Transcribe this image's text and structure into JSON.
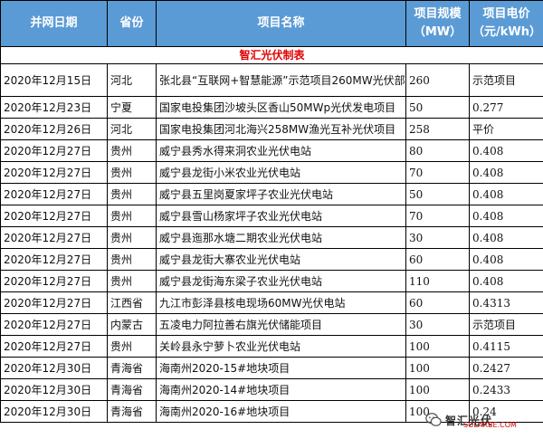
{
  "colors": {
    "header_bg": "#5b9bd5",
    "header_text": "#ffffff",
    "subtitle_text": "#e00000",
    "border": "#000000"
  },
  "header": {
    "col_date": "并网日期",
    "col_province": "省份",
    "col_name": "项目名称",
    "col_scale": "项目规模（MW）",
    "col_price": "项目电价（元/kWh）"
  },
  "subtitle": "智汇光伏制表",
  "rows": [
    {
      "date": "2020年12月15日",
      "province": "河北",
      "name": "张北县“互联网+智慧能源”示范项目260MW光伏部分",
      "scale": "260",
      "price": "示范项目"
    },
    {
      "date": "2020年12月23日",
      "province": "宁夏",
      "name": "国家电投集团沙坡头区香山50MWp光伏发电项目",
      "scale": "50",
      "price": "0.277"
    },
    {
      "date": "2020年12月26日",
      "province": "河北",
      "name": "国家电投集团河北海兴258MW渔光互补光伏项目",
      "scale": "258",
      "price": "平价"
    },
    {
      "date": "2020年12月27日",
      "province": "贵州",
      "name": "威宁县秀水得来洞农业光伏电站",
      "scale": "80",
      "price": "0.408"
    },
    {
      "date": "2020年12月27日",
      "province": "贵州",
      "name": "威宁县龙街小米农业光伏电站",
      "scale": "70",
      "price": "0.408"
    },
    {
      "date": "2020年12月27日",
      "province": "贵州",
      "name": "威宁县五里岗夏家坪子农业光伏电站",
      "scale": "50",
      "price": "0.408"
    },
    {
      "date": "2020年12月27日",
      "province": "贵州",
      "name": "威宁县雪山杨家坪子农业光伏电站",
      "scale": "70",
      "price": "0.408"
    },
    {
      "date": "2020年12月27日",
      "province": "贵州",
      "name": "威宁县迤那水塘二期农业光伏电站",
      "scale": "30",
      "price": "0.408"
    },
    {
      "date": "2020年12月27日",
      "province": "贵州",
      "name": "威宁县龙街大寨农业光伏电站",
      "scale": "60",
      "price": "0.408"
    },
    {
      "date": "2020年12月27日",
      "province": "贵州",
      "name": "威宁县龙街海东梁子农业光伏电站",
      "scale": "110",
      "price": "0.408"
    },
    {
      "date": "2020年12月27日",
      "province": "江西省",
      "name": "九江市彭泽县核电现场60MW光伏电站",
      "scale": "60",
      "price": "0.4313"
    },
    {
      "date": "2020年12月27日",
      "province": "内蒙古",
      "name": "五凌电力阿拉善右旗光伏储能项目",
      "scale": "30",
      "price": "示范项目"
    },
    {
      "date": "2020年12月27日",
      "province": "贵州",
      "name": "关岭县永宁萝卜农业光伏电站",
      "scale": "100",
      "price": "0.4115"
    },
    {
      "date": "2020年12月30日",
      "province": "青海省",
      "name": "海南州2020-15#地块项目",
      "scale": "100",
      "price": "0.2427"
    },
    {
      "date": "2020年12月30日",
      "province": "青海省",
      "name": "海南州2020-14#地块项目",
      "scale": "100",
      "price": "0.2433"
    },
    {
      "date": "2020年12月30日",
      "province": "青海省",
      "name": "海南州2020-16#地块项目",
      "scale": "100",
      "price": "0.24"
    }
  ],
  "watermark": {
    "text": "智汇光伏",
    "url": "SOLARBE.COM",
    "icon": "wechat-icon"
  }
}
